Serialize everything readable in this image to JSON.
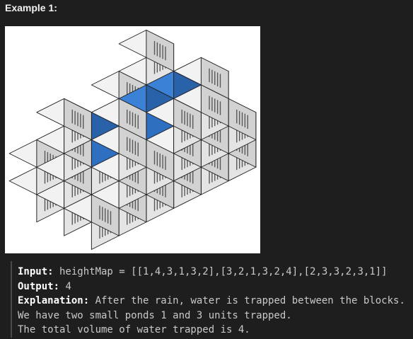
{
  "heading": "Example 1:",
  "figure": {
    "water_color": "#3b82d6",
    "block_color": "#f2f2f2"
  },
  "example": {
    "input_label": "Input:",
    "input_value": " heightMap = [[1,4,3,1,3,2],[3,2,1,3,2,4],[2,3,3,2,3,1]]",
    "output_label": "Output:",
    "output_value": " 4",
    "explanation_label": "Explanation:",
    "explanation_value": " After the rain, water is trapped between the blocks.",
    "explanation_line2": "We have two small ponds 1 and 3 units trapped.",
    "explanation_line3": "The total volume of water trapped is 4."
  }
}
